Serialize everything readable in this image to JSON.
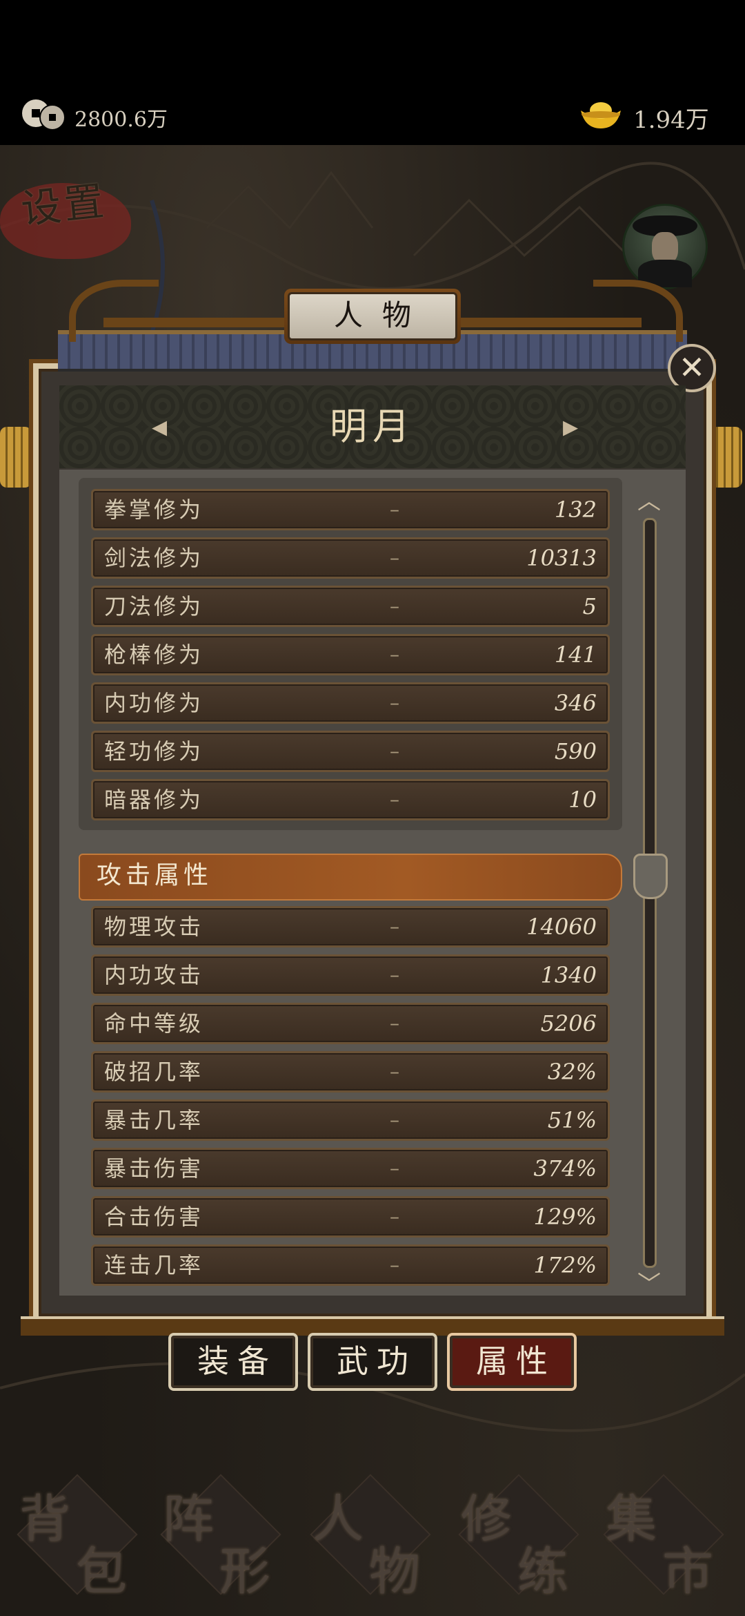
{
  "status_bar": {
    "coins": "2800.6万",
    "ingots": "1.94万"
  },
  "map": {
    "settings_label": "设置"
  },
  "panel": {
    "title": "人物",
    "character_name": "明月",
    "prev_arrow": "◂",
    "next_arrow": "▸",
    "close_symbol": "✕",
    "scroll_up": "︿",
    "scroll_down": "﹀",
    "cultivation_stats": [
      {
        "label": "拳掌修为",
        "dash": "–",
        "value": "132"
      },
      {
        "label": "剑法修为",
        "dash": "–",
        "value": "10313"
      },
      {
        "label": "刀法修为",
        "dash": "–",
        "value": "5"
      },
      {
        "label": "枪棒修为",
        "dash": "–",
        "value": "141"
      },
      {
        "label": "内功修为",
        "dash": "–",
        "value": "346"
      },
      {
        "label": "轻功修为",
        "dash": "–",
        "value": "590"
      },
      {
        "label": "暗器修为",
        "dash": "–",
        "value": "10"
      }
    ],
    "attack_section_title": "攻击属性",
    "attack_stats": [
      {
        "label": "物理攻击",
        "dash": "–",
        "value": "14060"
      },
      {
        "label": "内功攻击",
        "dash": "–",
        "value": "1340"
      },
      {
        "label": "命中等级",
        "dash": "–",
        "value": "5206"
      },
      {
        "label": "破招几率",
        "dash": "–",
        "value": "32%"
      },
      {
        "label": "暴击几率",
        "dash": "–",
        "value": "51%"
      },
      {
        "label": "暴击伤害",
        "dash": "–",
        "value": "374%"
      },
      {
        "label": "合击伤害",
        "dash": "–",
        "value": "129%"
      },
      {
        "label": "连击几率",
        "dash": "–",
        "value": "172%"
      }
    ]
  },
  "tabs": [
    {
      "label": "装备",
      "active": false
    },
    {
      "label": "武功",
      "active": false
    },
    {
      "label": "属性",
      "active": true
    }
  ],
  "bottom_nav": [
    {
      "char1": "背",
      "char2": "包"
    },
    {
      "char1": "阵",
      "char2": "形"
    },
    {
      "char1": "人",
      "char2": "物"
    },
    {
      "char1": "修",
      "char2": "练"
    },
    {
      "char1": "集",
      "char2": "市"
    }
  ],
  "colors": {
    "accent_active_tab": "#5a1a12",
    "section_header": "#a25a24",
    "row_bg": "#3a2c20"
  },
  "icons": {
    "coin": "coin-icon",
    "ingot": "gold-ingot-icon",
    "close": "close-icon",
    "avatar": "hero-avatar-icon"
  }
}
